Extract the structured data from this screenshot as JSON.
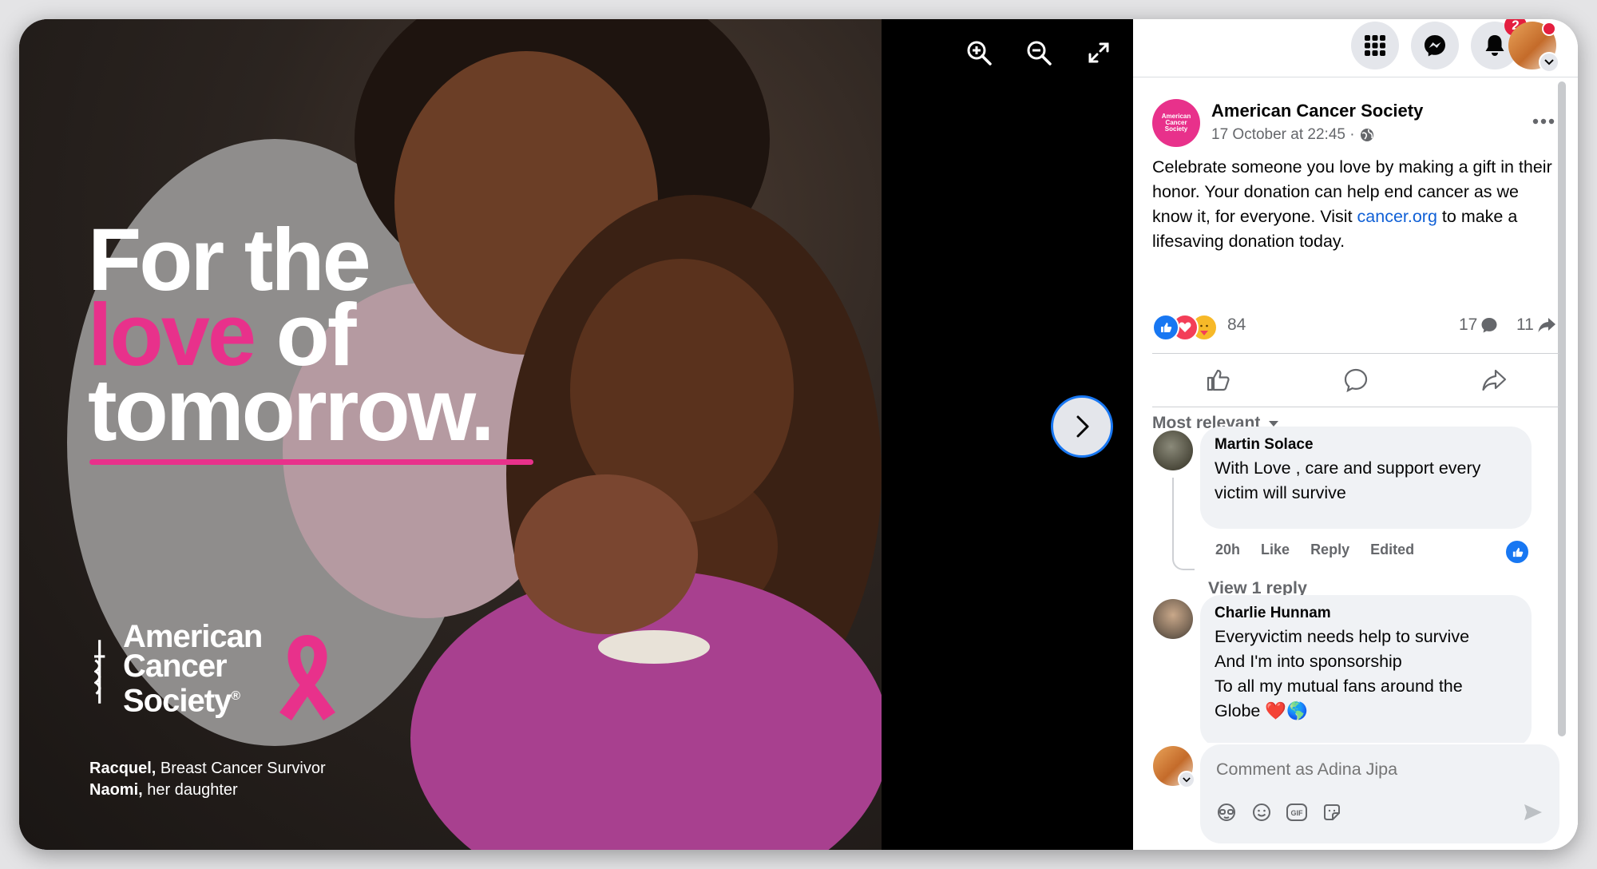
{
  "viewer": {
    "headline_line1": "For the",
    "headline_pink": "love",
    "headline_line2_rest": " of",
    "headline_line3": "tomorrow.",
    "logo_line1": "American",
    "logo_line2": "Cancer",
    "logo_line3": "Society",
    "logo_reg": "®",
    "caption1_name": "Racquel,",
    "caption1_rest": " Breast Cancer Survivor",
    "caption2_name": "Naomi,",
    "caption2_rest": " her daughter",
    "tools": [
      "zoom-in-icon",
      "zoom-out-icon",
      "fullscreen-icon"
    ],
    "next_icon": "chevron-right-icon",
    "brand_pink": "#e8318b"
  },
  "topbar": {
    "icons": [
      "menu-grid-icon",
      "messenger-icon",
      "bell-icon"
    ],
    "notification_count": "2"
  },
  "post": {
    "page_name": "American Cancer Society",
    "page_avatar_text": "American Cancer Society",
    "timestamp": "17 October at 22:45 ·",
    "audience_icon": "globe-icon",
    "text_before_link": "Celebrate someone you love by making a gift in their honor. Your donation can help end cancer as we know it, for everyone. Visit ",
    "link_text": "cancer.org",
    "text_after_link": " to make a lifesaving donation today.",
    "reaction_count": "84",
    "comment_count": "17",
    "share_count": "11"
  },
  "comments_sort": "Most relevant",
  "comments": [
    {
      "author": "Martin Solace",
      "text": "With Love , care and support every victim will survive",
      "time": "20h",
      "like": "Like",
      "reply": "Reply",
      "edited": "Edited",
      "view_replies": "View 1 reply"
    },
    {
      "author": "Charlie Hunnam",
      "text_lines": [
        "Everyvictim needs help to survive",
        "And I'm into sponsorship",
        "To all my mutual fans around the",
        "Globe ❤️🌎"
      ]
    }
  ],
  "composer": {
    "placeholder": "Comment as Adina Jipa",
    "tools": [
      "avatar-sticker-icon",
      "emoji-icon",
      "gif-icon",
      "sticker-icon"
    ],
    "send_icon": "send-icon"
  }
}
